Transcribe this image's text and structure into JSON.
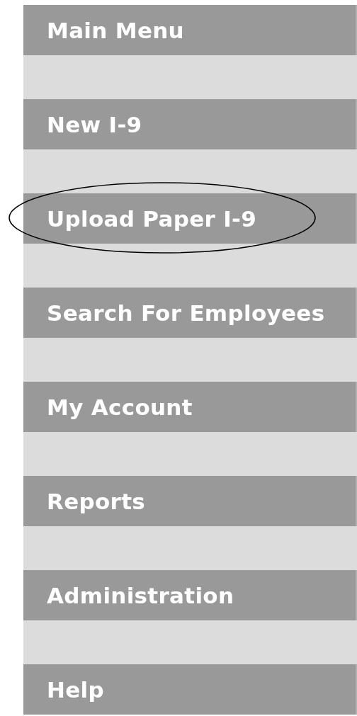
{
  "menu": [
    {
      "label": "Main Menu",
      "circled": false
    },
    {
      "label": "New I-9",
      "circled": false
    },
    {
      "label": "Upload Paper I-9",
      "circled": true
    },
    {
      "label": "Search For Employees",
      "circled": false
    },
    {
      "label": "My Account",
      "circled": false
    },
    {
      "label": "Reports",
      "circled": false
    },
    {
      "label": "Administration",
      "circled": false
    },
    {
      "label": "Help",
      "circled": false
    }
  ]
}
